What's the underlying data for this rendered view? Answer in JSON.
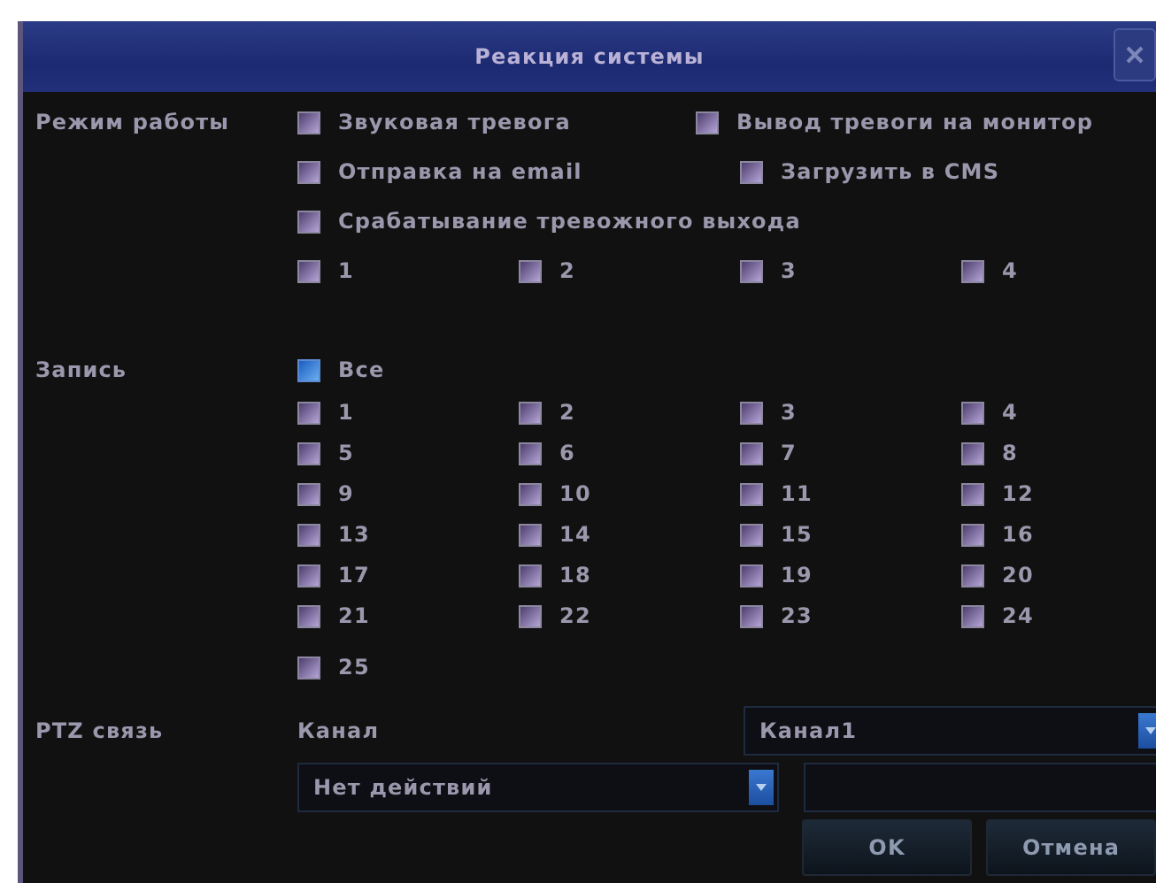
{
  "window": {
    "title": "Реакция системы"
  },
  "mode": {
    "label": "Режим работы",
    "options": [
      {
        "label": "Звуковая тревога",
        "focused": false
      },
      {
        "label": "Вывод тревоги на монитор",
        "focused": false
      },
      {
        "label": "Отправка на email",
        "focused": false
      },
      {
        "label": "Загрузить в CMS",
        "focused": false
      },
      {
        "label": "Срабатывание тревожного выхода",
        "focused": false
      }
    ],
    "alarm_outputs": [
      {
        "label": "1",
        "focused": false
      },
      {
        "label": "2",
        "focused": false
      },
      {
        "label": "3",
        "focused": false
      },
      {
        "label": "4",
        "focused": false
      }
    ]
  },
  "record": {
    "label": "Запись",
    "all": {
      "label": "Все",
      "focused": true
    },
    "channels": [
      {
        "label": "1",
        "focused": false
      },
      {
        "label": "2",
        "focused": false
      },
      {
        "label": "3",
        "focused": false
      },
      {
        "label": "4",
        "focused": false
      },
      {
        "label": "5",
        "focused": false
      },
      {
        "label": "6",
        "focused": false
      },
      {
        "label": "7",
        "focused": false
      },
      {
        "label": "8",
        "focused": false
      },
      {
        "label": "9",
        "focused": false
      },
      {
        "label": "10",
        "focused": false
      },
      {
        "label": "11",
        "focused": false
      },
      {
        "label": "12",
        "focused": false
      },
      {
        "label": "13",
        "focused": false
      },
      {
        "label": "14",
        "focused": false
      },
      {
        "label": "15",
        "focused": false
      },
      {
        "label": "16",
        "focused": false
      },
      {
        "label": "17",
        "focused": false
      },
      {
        "label": "18",
        "focused": false
      },
      {
        "label": "19",
        "focused": false
      },
      {
        "label": "20",
        "focused": false
      },
      {
        "label": "21",
        "focused": false
      },
      {
        "label": "22",
        "focused": false
      },
      {
        "label": "23",
        "focused": false
      },
      {
        "label": "24",
        "focused": false
      },
      {
        "label": "25",
        "focused": false
      }
    ]
  },
  "ptz": {
    "label": "PTZ связь",
    "channel_label": "Канал",
    "channel_value": "Канал1",
    "action_value": "Нет действий"
  },
  "buttons": [
    "OK",
    "Отмена"
  ]
}
